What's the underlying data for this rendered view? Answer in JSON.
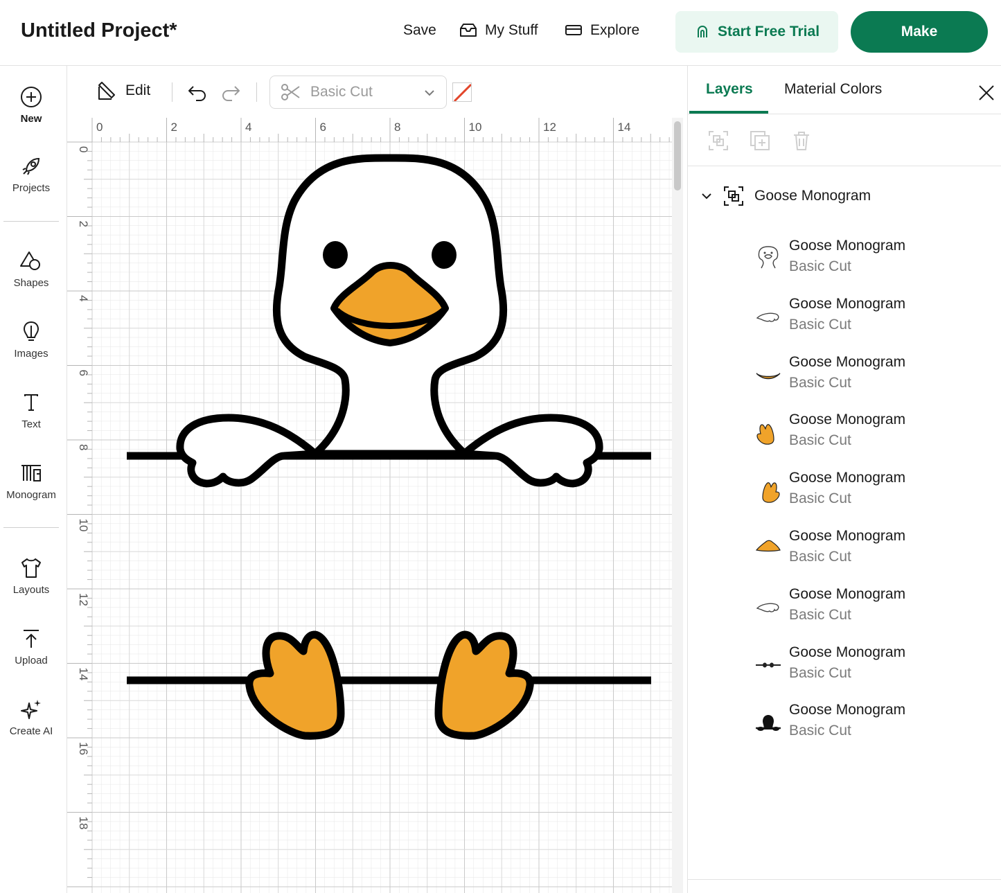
{
  "header": {
    "project_title": "Untitled Project*",
    "save": "Save",
    "my_stuff": "My Stuff",
    "explore": "Explore",
    "start_trial": "Start Free Trial",
    "make": "Make"
  },
  "sidebar": {
    "items": [
      {
        "label": "New",
        "icon": "plus-circle-icon"
      },
      {
        "label": "Projects",
        "icon": "rocket-icon"
      },
      {
        "label": "Shapes",
        "icon": "shapes-icon"
      },
      {
        "label": "Images",
        "icon": "lightbulb-icon"
      },
      {
        "label": "Text",
        "icon": "text-icon"
      },
      {
        "label": "Monogram",
        "icon": "monogram-icon"
      },
      {
        "label": "Layouts",
        "icon": "tshirt-icon"
      },
      {
        "label": "Upload",
        "icon": "upload-icon"
      },
      {
        "label": "Create AI",
        "icon": "sparkle-icon"
      }
    ]
  },
  "toolbar": {
    "edit": "Edit",
    "operation": "Basic Cut"
  },
  "ruler": {
    "top": [
      "0",
      "2",
      "4",
      "6",
      "8",
      "10",
      "12",
      "14"
    ],
    "left": [
      "0",
      "2",
      "4",
      "6",
      "8",
      "10",
      "12",
      "14",
      "16",
      "18"
    ]
  },
  "panel": {
    "tabs": [
      "Layers",
      "Material Colors"
    ],
    "group_name": "Goose Monogram",
    "layers": [
      {
        "name": "Goose Monogram",
        "op": "Basic Cut",
        "thumb": "goose-head-outline"
      },
      {
        "name": "Goose Monogram",
        "op": "Basic Cut",
        "thumb": "wing-outline"
      },
      {
        "name": "Goose Monogram",
        "op": "Basic Cut",
        "thumb": "beak-smile"
      },
      {
        "name": "Goose Monogram",
        "op": "Basic Cut",
        "thumb": "foot-left"
      },
      {
        "name": "Goose Monogram",
        "op": "Basic Cut",
        "thumb": "foot-right"
      },
      {
        "name": "Goose Monogram",
        "op": "Basic Cut",
        "thumb": "beak-top"
      },
      {
        "name": "Goose Monogram",
        "op": "Basic Cut",
        "thumb": "wing-outline-2"
      },
      {
        "name": "Goose Monogram",
        "op": "Basic Cut",
        "thumb": "eyes-line"
      },
      {
        "name": "Goose Monogram",
        "op": "Basic Cut",
        "thumb": "goose-silhouette"
      }
    ]
  },
  "colors": {
    "accent": "#0b7a52",
    "trial_bg": "#eaf7f1",
    "beak": "#f0a32a",
    "outline": "#000000"
  }
}
